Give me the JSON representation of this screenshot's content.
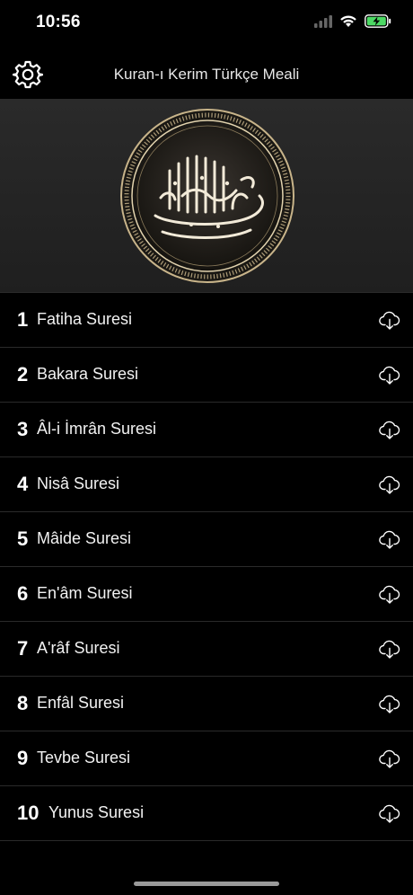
{
  "status": {
    "time": "10:56"
  },
  "nav": {
    "title": "Kuran-ı Kerim Türkçe Meali"
  },
  "colors": {
    "background": "#000000",
    "banner": "#252525",
    "battery": "#4cd964",
    "gold": "#c8b48a"
  },
  "surahs": [
    {
      "num": "1",
      "name": "Fatiha Suresi"
    },
    {
      "num": "2",
      "name": "Bakara Suresi"
    },
    {
      "num": "3",
      "name": "Âl-i İmrân Suresi"
    },
    {
      "num": "4",
      "name": "Nisâ Suresi"
    },
    {
      "num": "5",
      "name": "Mâide Suresi"
    },
    {
      "num": "6",
      "name": "En'âm Suresi"
    },
    {
      "num": "7",
      "name": "A'râf Suresi"
    },
    {
      "num": "8",
      "name": "Enfâl Suresi"
    },
    {
      "num": "9",
      "name": "Tevbe Suresi"
    },
    {
      "num": "10",
      "name": "Yunus Suresi"
    }
  ]
}
